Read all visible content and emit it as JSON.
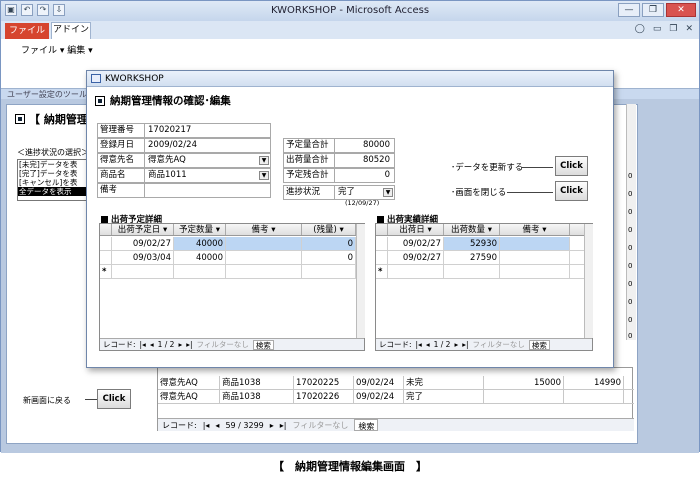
{
  "app": {
    "title": "KWORKSHOP - Microsoft Access",
    "quick_access": [
      "▣",
      "↶",
      "↷",
      "⇩"
    ],
    "tabs": {
      "file": "ファイル",
      "addin": "アドイン"
    },
    "ribbon_menu": "ファイル ▾  編集 ▾",
    "ribbon_group": "ユーザー設定のツール",
    "window_controls": {
      "minimize": "—",
      "restore": "❐",
      "close": "✕"
    },
    "tab_right_controls": [
      "◯",
      "▭",
      "❐",
      "✕"
    ]
  },
  "background_form": {
    "title": "【 納期管理",
    "filter_label": "＜進捗状況の選択＞",
    "list_items": [
      "[未完]データを表",
      "[完了]データを表",
      "[キャンセル]を表",
      "全データを表示"
    ],
    "selected_index": 3,
    "new_screen_label": "新画面に戻る",
    "new_screen_button": "Click",
    "grid_rows": [
      [
        "得意先AQ",
        "商品1038",
        "17020225",
        "09/02/24",
        "未完",
        "15000",
        "14990"
      ],
      [
        "得意先AQ",
        "商品1038",
        "17020226",
        "09/02/24",
        "完了",
        "",
        ""
      ]
    ],
    "grid_nav": {
      "label": "レコード:",
      "position": "59 / 3299",
      "filter": "フィルターなし",
      "search": "検索"
    },
    "vscroll_marks": [
      "0",
      "0",
      "0",
      "0",
      "0",
      "0",
      "0",
      "0",
      "0",
      "0"
    ]
  },
  "dialog": {
    "window_title": "KWORKSHOP",
    "heading": "納期管理情報の確認･編集",
    "fields_left": [
      {
        "label": "管理番号",
        "value": "17020217",
        "dropdown": false
      },
      {
        "label": "登録月日",
        "value": "2009/02/24",
        "dropdown": false
      },
      {
        "label": "得意先名",
        "value": "得意先AQ",
        "dropdown": true
      },
      {
        "label": "商品名",
        "value": "商品1011",
        "dropdown": true
      },
      {
        "label": "備考",
        "value": "",
        "dropdown": false
      }
    ],
    "fields_right": [
      {
        "label": "予定量合計",
        "value": "80000"
      },
      {
        "label": "出荷量合計",
        "value": "80520"
      },
      {
        "label": "予定残合計",
        "value": "0"
      }
    ],
    "status": {
      "label": "進捗状況",
      "value": "完了",
      "date_note": "(12/09/27)"
    },
    "actions": [
      {
        "label": "･データを更新する",
        "button": "Click"
      },
      {
        "label": "･画面を閉じる",
        "button": "Click"
      }
    ],
    "plan_subform": {
      "title": "出荷予定詳細",
      "headers": [
        "",
        "出荷予定日 ▾",
        "予定数量 ▾",
        "備考 ▾",
        "(残量) ▾"
      ],
      "rows": [
        [
          "",
          "09/02/27",
          "40000",
          "",
          "0"
        ],
        [
          "",
          "09/03/04",
          "40000",
          "",
          "0"
        ],
        [
          "*",
          "",
          "",
          "",
          ""
        ]
      ],
      "nav": {
        "label": "レコード:",
        "position": "1 / 2",
        "filter": "フィルターなし",
        "search": "検索"
      }
    },
    "actual_subform": {
      "title": "出荷実績詳細",
      "headers": [
        "",
        "出荷日 ▾",
        "出荷数量 ▾",
        "備考 ▾"
      ],
      "rows": [
        [
          "",
          "09/02/27",
          "52930",
          ""
        ],
        [
          "",
          "09/02/27",
          "27590",
          ""
        ],
        [
          "*",
          "",
          "",
          ""
        ]
      ],
      "nav": {
        "label": "レコード:",
        "position": "1 / 2",
        "filter": "フィルターなし",
        "search": "検索"
      }
    }
  },
  "caption": "【　納期管理情報編集画面　】"
}
